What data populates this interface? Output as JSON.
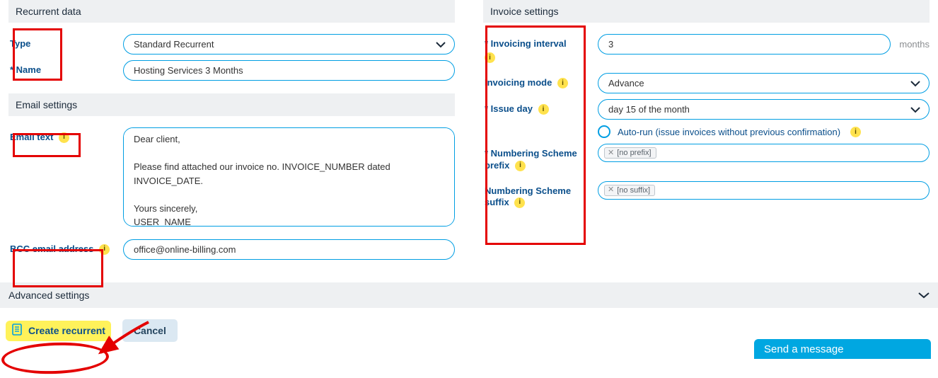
{
  "left": {
    "recurrent": {
      "header": "Recurrent data",
      "type_label": "Type",
      "type_value": "Standard Recurrent",
      "name_label": "Name",
      "name_value": "Hosting Services 3 Months"
    },
    "email": {
      "header": "Email settings",
      "text_label": "Email text",
      "text_value": "Dear client,\n\nPlease find attached our invoice no. INVOICE_NUMBER dated INVOICE_DATE.\n\nYours sincerely,\nUSER_NAME\nCOMPANY_NAME",
      "bcc_label": "BCC email address",
      "bcc_value": "office@online-billing.com"
    }
  },
  "right": {
    "header": "Invoice settings",
    "interval_label": "Invoicing interval",
    "interval_value": "3",
    "interval_suffix": "months",
    "mode_label": "Invoicing mode",
    "mode_value": "Advance",
    "issue_label": "Issue day",
    "issue_value": "day 15 of the month",
    "autorun_label": "Auto-run (issue invoices without previous confirmation)",
    "prefix_label": "Numbering Scheme prefix",
    "prefix_tag": "[no prefix]",
    "suffix_label": "Numbering Scheme suffix",
    "suffix_tag": "[no suffix]"
  },
  "advanced": {
    "label": "Advanced settings"
  },
  "actions": {
    "create": "Create recurrent",
    "cancel": "Cancel"
  },
  "chat": {
    "label": "Send a message"
  },
  "info_glyph": "i"
}
